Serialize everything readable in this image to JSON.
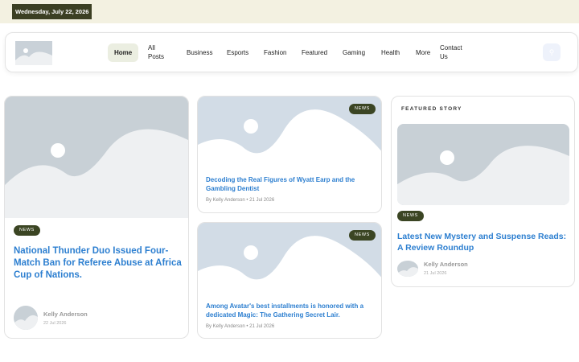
{
  "topbar": {
    "date": "Wednesday, July 22, 2026"
  },
  "nav": {
    "home": "Home",
    "all_posts": "All Posts",
    "business": "Business",
    "esports": "Esports",
    "fashion": "Fashion",
    "featured": "Featured",
    "gaming": "Gaming",
    "health": "Health",
    "more": "More",
    "contact": "Contact Us"
  },
  "main_post": {
    "badge": "NEWS",
    "title": "National Thunder Duo Issued Four-Match Ban for Referee Abuse at Africa Cup of Nations.",
    "author": "Kelly Anderson",
    "date": "22 Jul 2026"
  },
  "mid_posts": [
    {
      "badge": "NEWS",
      "title": "Decoding the Real Figures of Wyatt Earp and the Gambling Dentist",
      "meta": "By Kelly Anderson   • 21 Jul 2026"
    },
    {
      "badge": "NEWS",
      "title": "Among Avatar's best installments is honored with a dedicated Magic: The Gathering Secret Lair.",
      "meta": "By Kelly Anderson   • 21 Jul 2026"
    }
  ],
  "featured": {
    "label": "FEATURED STORY",
    "badge": "NEWS",
    "title": "Latest New Mystery and Suspense Reads: A Review Roundup",
    "author": "Kelly Anderson",
    "date": "21 Jul 2026"
  },
  "icons": {
    "search": "search-icon"
  }
}
